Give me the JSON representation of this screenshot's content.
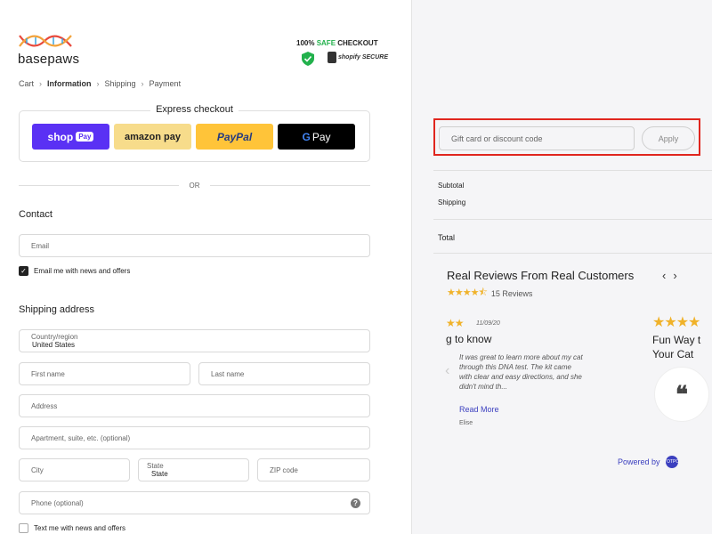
{
  "brand": {
    "name": "basepaws"
  },
  "secure": {
    "prefix": "100% ",
    "safe": "SAFE",
    "suffix": " CHECKOUT",
    "shopify_badge": "shopify SECURE"
  },
  "breadcrumb": {
    "items": [
      "Cart",
      "Information",
      "Shipping",
      "Payment"
    ],
    "current": "Information"
  },
  "express": {
    "title": "Express checkout",
    "buttons": {
      "shop_pay": "shop",
      "shop_pay_tag": "Pay",
      "amazon_pay": "amazon pay",
      "paypal": "PayPal",
      "google_pay": "Pay",
      "google_g": "G"
    }
  },
  "or_label": "OR",
  "contact": {
    "heading": "Contact",
    "email_placeholder": "Email",
    "newsletter_label": "Email me with news and offers",
    "newsletter_checked": true
  },
  "shipping": {
    "heading": "Shipping address",
    "country_label": "Country/region",
    "country_value": "United States",
    "first_name": "First name",
    "last_name": "Last name",
    "address": "Address",
    "apartment": "Apartment, suite, etc. (optional)",
    "city": "City",
    "state_label": "State",
    "state_value": "State",
    "zip": "ZIP code",
    "phone": "Phone (optional)",
    "text_label": "Text me with news and offers",
    "text_checked": false
  },
  "summary": {
    "discount_placeholder": "Gift card or discount code",
    "apply_label": "Apply",
    "subtotal_label": "Subtotal",
    "shipping_label": "Shipping",
    "total_label": "Total"
  },
  "reviews": {
    "title": "Real Reviews From Real Customers",
    "rating": 4.5,
    "count_label": "15 Reviews",
    "card1": {
      "date": "11/09/20",
      "title": "g to know",
      "body": "It was great to learn more about my cat through this DNA test. The kit came with clear and easy directions, and she didn't mind th...",
      "read_more": "Read More",
      "author": "Elise"
    },
    "card2": {
      "title_line1": "Fun Way t",
      "title_line2": "Your Cat"
    },
    "powered_by": "Powered by",
    "powered_badge": "YOTPO"
  },
  "colors": {
    "accent": "#3b3fbf",
    "highlight": "#e0261e",
    "star": "#f0b22a",
    "shop_pay": "#5a31f4",
    "paypal": "#ffc439"
  }
}
